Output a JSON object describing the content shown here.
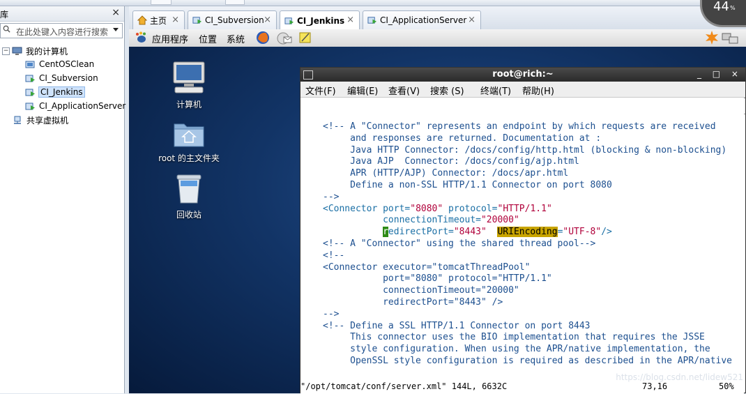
{
  "library": {
    "title": "库",
    "close": "×",
    "search_placeholder": "在此处键入内容进行搜索",
    "tree": {
      "root": "我的计算机",
      "items": [
        "CentOSClean",
        "CI_Subversion",
        "CI_Jenkins",
        "CI_ApplicationServer"
      ],
      "shared": "共享虚拟机"
    }
  },
  "tabs": [
    {
      "label": "主页"
    },
    {
      "label": "CI_Subversion"
    },
    {
      "label": "CI_Jenkins"
    },
    {
      "label": "CI_ApplicationServer"
    }
  ],
  "tab_close": "×",
  "gnome_panel": {
    "applications": "应用程序",
    "places": "位置",
    "system": "系统"
  },
  "desktop_icons": {
    "computer": "计算机",
    "home": "root 的主文件夹",
    "trash": "回收站"
  },
  "terminal": {
    "title": "root@rich:~",
    "menu": [
      "文件(F)",
      "编辑(E)",
      "查看(V)",
      "搜索 (S)",
      "终端(T)",
      "帮助(H)"
    ],
    "lines": {
      "l1": "<!-- A \"Connector\" represents an endpoint by which requests are received",
      "l2": "     and responses are returned. Documentation at :",
      "l3": "     Java HTTP Connector: /docs/config/http.html (blocking & non-blocking)",
      "l4": "     Java AJP  Connector: /docs/config/ajp.html",
      "l5": "     APR (HTTP/AJP) Connector: /docs/apr.html",
      "l6": "     Define a non-SSL HTTP/1.1 Connector on port 8080",
      "l7": "-->",
      "l8_tag": "<Connector",
      "l8_port_attr": " port=",
      "l8_port_val": "\"8080\"",
      "l8_proto_attr": " protocol=",
      "l8_proto_val": "\"HTTP/1.1\"",
      "l9_attr": "           connectionTimeout=",
      "l9_val": "\"20000\"",
      "l10_pad": "           ",
      "l10_cursor": "r",
      "l10_attr": "edirectPort=",
      "l10_val": "\"8443\"",
      "l10_sp": "  ",
      "l10_hl": "URIEncoding",
      "l10_eq": "=",
      "l10_val2": "\"UTF-8\"",
      "l10_end": "/>",
      "l11": "<!-- A \"Connector\" using the shared thread pool-->",
      "l12": "<!--",
      "l13": "<Connector executor=\"tomcatThreadPool\"",
      "l14": "           port=\"8080\" protocol=\"HTTP/1.1\"",
      "l15": "           connectionTimeout=\"20000\"",
      "l16": "           redirectPort=\"8443\" />",
      "l17": "-->",
      "l18": "<!-- Define a SSL HTTP/1.1 Connector on port 8443",
      "l19": "     This connector uses the BIO implementation that requires the JSSE",
      "l20": "     style configuration. When using the APR/native implementation, the",
      "l21": "     OpenSSL style configuration is required as described in the APR/native"
    },
    "status": {
      "file": "\"/opt/tomcat/conf/server.xml\" 144L, 6632C",
      "pos": "73,16",
      "pct": "50%"
    }
  },
  "perf": {
    "value": "44",
    "unit": "%"
  },
  "watermark": "https://blog.csdn.net/lidew521",
  "colors": {
    "desktop": "#123466",
    "accent": "#1a6fa5",
    "cursor": "#2e8b16",
    "highlight": "#c8a400"
  }
}
